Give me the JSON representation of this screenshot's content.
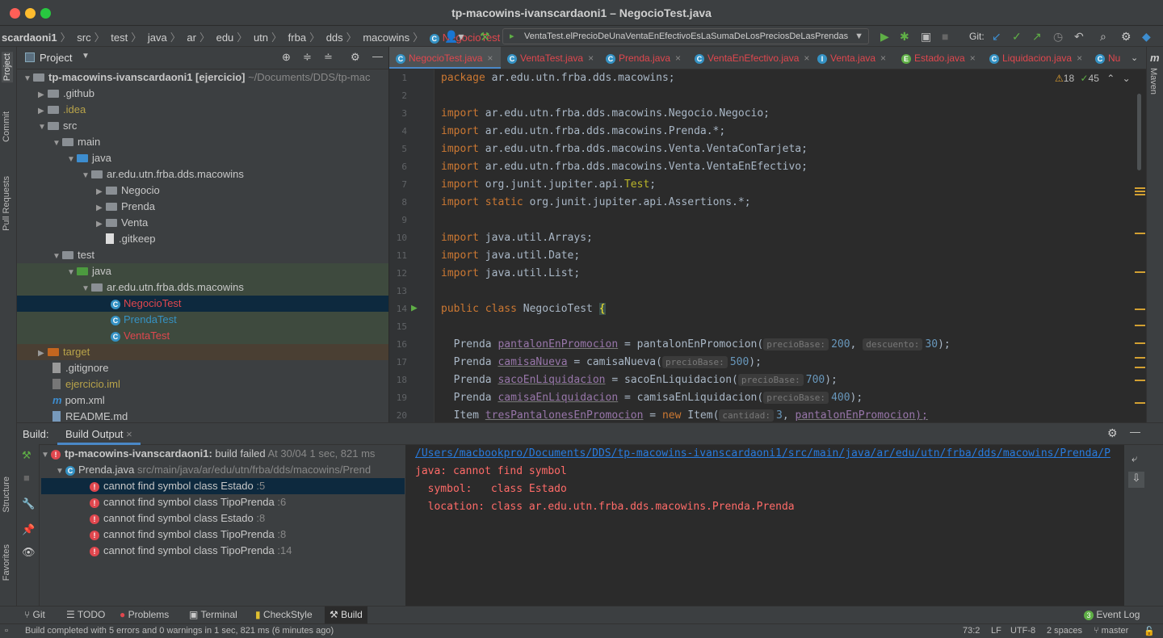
{
  "window": {
    "title": "tp-macowins-ivanscardaoni1 – NegocioTest.java"
  },
  "breadcrumbs": [
    "scardaoni1",
    "src",
    "test",
    "java",
    "ar",
    "edu",
    "utn",
    "frba",
    "dds",
    "macowins",
    "NegocioTest"
  ],
  "toolbar": {
    "run_config": "VentaTest.elPrecioDeUnaVentaEnEfectivoEsLaSumaDeLosPreciosDeLasPrendas",
    "git_label": "Git:"
  },
  "left_strip": {
    "project": "Project",
    "commit": "Commit",
    "pull_requests": "Pull Requests",
    "structure": "Structure",
    "favorites": "Favorites"
  },
  "right_strip": {
    "maven": "Maven"
  },
  "project_panel": {
    "title": "Project",
    "root_label": "tp-macowins-ivanscardaoni1 [ejercicio]",
    "root_path": "~/Documents/DDS/tp-mac",
    "github": ".github",
    "idea": ".idea",
    "src": "src",
    "main": "main",
    "java": "java",
    "pkg": "ar.edu.utn.frba.dds.macowins",
    "negocio": "Negocio",
    "prenda": "Prenda",
    "venta": "Venta",
    "gitkeep": ".gitkeep",
    "test": "test",
    "java2": "java",
    "pkg2": "ar.edu.utn.frba.dds.macowins",
    "negociotest": "NegocioTest",
    "prendatest": "PrendaTest",
    "ventatest": "VentaTest",
    "target": "target",
    "gitignore": ".gitignore",
    "iml": "ejercicio.iml",
    "pom": "pom.xml",
    "readme": "README.md"
  },
  "tabs": [
    "NegocioTest.java",
    "VentaTest.java",
    "Prenda.java",
    "VentaEnEfectivo.java",
    "Venta.java",
    "Estado.java",
    "Liquidacion.java",
    "Nu"
  ],
  "inspections": {
    "warnings": "18",
    "ok": "45"
  },
  "editor": {
    "line_numbers": [
      "1",
      "2",
      "3",
      "4",
      "5",
      "6",
      "7",
      "8",
      "9",
      "10",
      "11",
      "12",
      "13",
      "14",
      "15",
      "16",
      "17",
      "18",
      "19",
      "20"
    ],
    "l1a": "package",
    "l1b": "ar.edu.utn.frba.dds.macowins;",
    "imp": "import",
    "static": "static",
    "l3": "ar.edu.utn.frba.dds.macowins.Negocio.Negocio;",
    "l4": "ar.edu.utn.frba.dds.macowins.Prenda.*;",
    "l5": "ar.edu.utn.frba.dds.macowins.Venta.VentaConTarjeta;",
    "l6": "ar.edu.utn.frba.dds.macowins.Venta.VentaEnEfectivo;",
    "l7a": "org.junit.jupiter.api.",
    "l7b": "Test",
    "l7c": ";",
    "l8": "org.junit.jupiter.api.Assertions.*;",
    "l10": "java.util.Arrays;",
    "l11": "java.util.Date;",
    "l12": "java.util.List;",
    "l14a": "public",
    "l14b": "class",
    "l14c": "NegocioTest",
    "l14d": "{",
    "prenda": "Prenda",
    "item": "Item",
    "eq": "=",
    "new": "new",
    "l16v": "pantalonEnPromocion",
    "l16f": "pantalonEnPromocion(",
    "h_precioBase": "precioBase:",
    "l16n1": "200",
    "h_descuento": "descuento:",
    "l16n2": "30",
    "close": ");",
    "l17v": "camisaNueva",
    "l17f": "camisaNueva(",
    "l17n": "500",
    "l18v": "sacoEnLiquidacion",
    "l18f": "sacoEnLiquidacion(",
    "l18n": "700",
    "l19v": "camisaEnLiquidacion",
    "l19f": "camisaEnLiquidacion(",
    "l19n": "400",
    "l20v": "tresPantalonesEnPromocion",
    "l20f": "Item(",
    "h_cantidad": "cantidad:",
    "l20n": "3",
    "l20arg": "pantalonEnPromocion);"
  },
  "build": {
    "label": "Build:",
    "tab": "Build Output",
    "root": "tp-macowins-ivanscardaoni1:",
    "root_status": "build failed",
    "root_time": "At 30/04 1 sec, 821 ms",
    "file": "Prenda.java",
    "file_path": "src/main/java/ar/edu/utn/frba/dds/macowins/Prend",
    "errors": [
      {
        "text": "cannot find symbol class Estado",
        "line": ":5"
      },
      {
        "text": "cannot find symbol class TipoPrenda",
        "line": ":6"
      },
      {
        "text": "cannot find symbol class Estado",
        "line": ":8"
      },
      {
        "text": "cannot find symbol class TipoPrenda",
        "line": ":8"
      },
      {
        "text": "cannot find symbol class TipoPrenda",
        "line": ":14"
      }
    ],
    "console": {
      "link": "/Users/macbookpro/Documents/DDS/tp-macowins-ivanscardaoni1/src/main/java/ar/edu/utn/frba/dds/macowins/Prenda/P",
      "l2": "java: cannot find symbol",
      "l3": "  symbol:   class Estado",
      "l4": "  location: class ar.edu.utn.frba.dds.macowins.Prenda.Prenda"
    }
  },
  "tool_windows": [
    "Git",
    "TODO",
    "Problems",
    "Terminal",
    "CheckStyle",
    "Build"
  ],
  "event_log": "Event Log",
  "event_log_count": "3",
  "status": {
    "message": "Build completed with 5 errors and 0 warnings in 1 sec, 821 ms (6 minutes ago)",
    "pos": "73:2",
    "lf": "LF",
    "enc": "UTF-8",
    "indent": "2 spaces",
    "branch": "master"
  }
}
